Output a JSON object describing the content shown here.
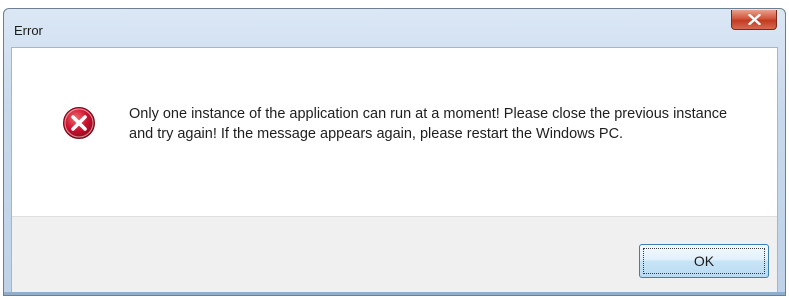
{
  "window": {
    "title": "Error",
    "close_icon": "close-x-icon"
  },
  "dialog": {
    "icon": "error-icon",
    "message": "Only one instance of the application can run at a moment! Please close the previous instance and try again! If the message appears again, please restart the Windows PC."
  },
  "buttons": {
    "ok_label": "OK"
  },
  "colors": {
    "error_red": "#c8102e",
    "close_button": "#c94b33",
    "title_bar": "#c9d9ec",
    "footer_bg": "#f0f0f0"
  }
}
